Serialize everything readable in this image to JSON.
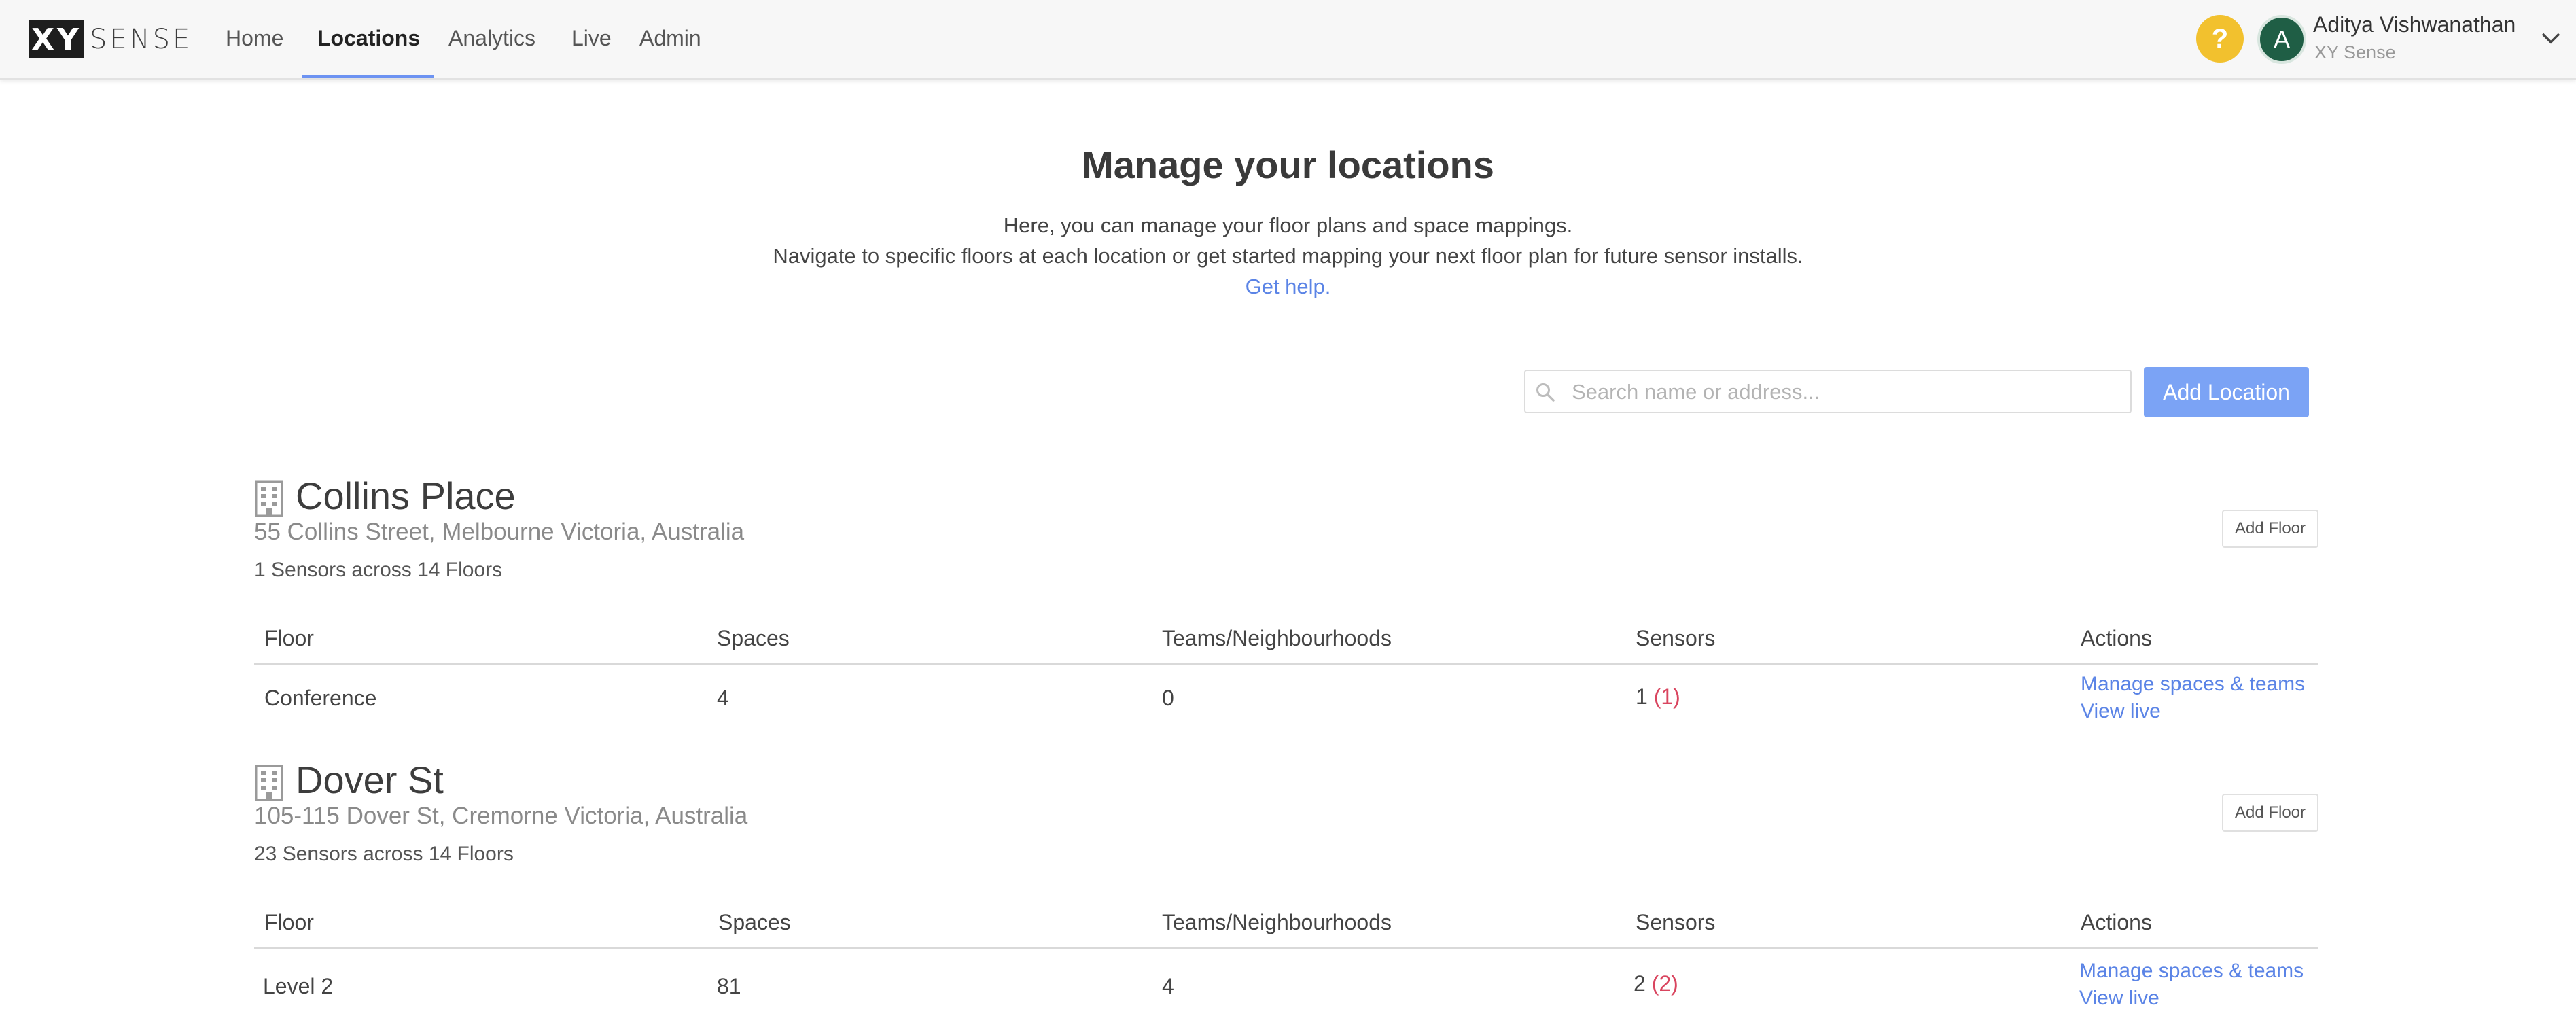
{
  "brand": {
    "mark": "XY",
    "text": "SENSE"
  },
  "nav": {
    "items": [
      {
        "label": "Home"
      },
      {
        "label": "Locations",
        "active": true
      },
      {
        "label": "Analytics"
      },
      {
        "label": "Live"
      },
      {
        "label": "Admin"
      }
    ]
  },
  "user": {
    "help": "?",
    "initial": "A",
    "name": "Aditya Vishwanathan",
    "org": "XY Sense"
  },
  "header": {
    "title": "Manage your locations",
    "line1": "Here, you can manage your floor plans and space mappings.",
    "line2": "Navigate to specific floors at each location or get started mapping your next floor plan for future sensor installs.",
    "help_link": "Get help."
  },
  "search": {
    "placeholder": "Search name or address...",
    "value": ""
  },
  "add_location_label": "Add Location",
  "table_headers": {
    "floor": "Floor",
    "spaces": "Spaces",
    "teams": "Teams/Neighbourhoods",
    "sensors": "Sensors",
    "actions": "Actions"
  },
  "locations": [
    {
      "name": "Collins Place",
      "address": "55 Collins Street, Melbourne Victoria, Australia",
      "stats": "1 Sensors across 14 Floors",
      "add_floor": "Add Floor",
      "rows": [
        {
          "floor": "Conference",
          "spaces": "4",
          "teams": "0",
          "sensors": "1",
          "sensors_offline": "(1)",
          "manage": "Manage spaces & teams",
          "view": "View live"
        }
      ]
    },
    {
      "name": "Dover St",
      "address": "105-115 Dover St, Cremorne Victoria, Australia",
      "stats": "23 Sensors across 14 Floors",
      "add_floor": "Add Floor",
      "rows": [
        {
          "floor": "Level 2",
          "spaces": "81",
          "teams": "4",
          "sensors": "2",
          "sensors_offline": "(2)",
          "manage": "Manage spaces & teams",
          "view": "View live"
        }
      ]
    }
  ],
  "colors": {
    "accent": "#7ba3f5",
    "link": "#5b84e6",
    "warning": "#d9455f",
    "help": "#f2c12e",
    "avatar": "#1f5e45"
  }
}
